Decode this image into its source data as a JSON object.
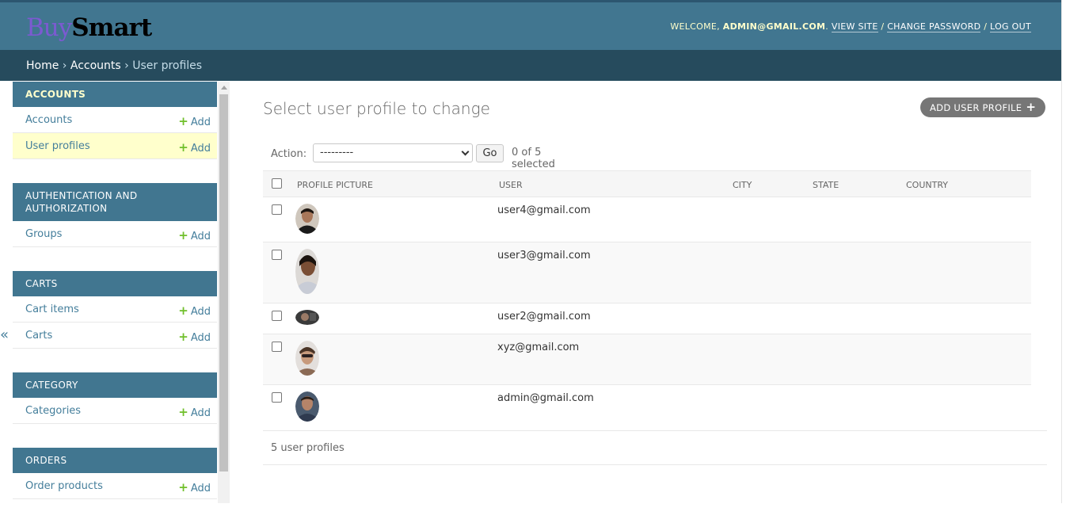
{
  "header": {
    "brand_part1": "Buy",
    "brand_part2": "Smart",
    "welcome": "WELCOME,",
    "user": "ADMIN@GMAIL.COM",
    "view_site": "VIEW SITE",
    "change_password": "CHANGE PASSWORD",
    "log_out": "LOG OUT"
  },
  "breadcrumbs": {
    "home": "Home",
    "accounts": "Accounts",
    "current": "User profiles",
    "separator": "›"
  },
  "sidebar": {
    "add_label": "Add",
    "collapse": "«",
    "modules": [
      {
        "caption": "ACCOUNTS",
        "rows": [
          {
            "name": "Accounts"
          },
          {
            "name": "User profiles"
          }
        ]
      },
      {
        "caption": "AUTHENTICATION AND AUTHORIZATION",
        "rows": [
          {
            "name": "Groups"
          }
        ]
      },
      {
        "caption": "CARTS",
        "rows": [
          {
            "name": "Cart items"
          },
          {
            "name": "Carts"
          }
        ]
      },
      {
        "caption": "CATEGORY",
        "rows": [
          {
            "name": "Categories"
          }
        ]
      },
      {
        "caption": "ORDERS",
        "rows": [
          {
            "name": "Order products"
          }
        ]
      }
    ]
  },
  "main": {
    "title": "Select user profile to change",
    "add_button": "ADD USER PROFILE",
    "action_label": "Action:",
    "action_value": "---------",
    "go": "Go",
    "selected": "0 of 5 selected",
    "columns": [
      "PROFILE PICTURE",
      "USER",
      "CITY",
      "STATE",
      "COUNTRY"
    ],
    "rows": [
      {
        "user": "user4@gmail.com"
      },
      {
        "user": "user3@gmail.com"
      },
      {
        "user": "user2@gmail.com"
      },
      {
        "user": "xyz@gmail.com"
      },
      {
        "user": "admin@gmail.com"
      }
    ],
    "count": "5 user profiles"
  },
  "colors": {
    "header": "#417690",
    "breadcrumbs": "#264b5d",
    "link": "#447e9b",
    "add_plus": "#70bf2b",
    "current_row": "#ffffcc"
  }
}
